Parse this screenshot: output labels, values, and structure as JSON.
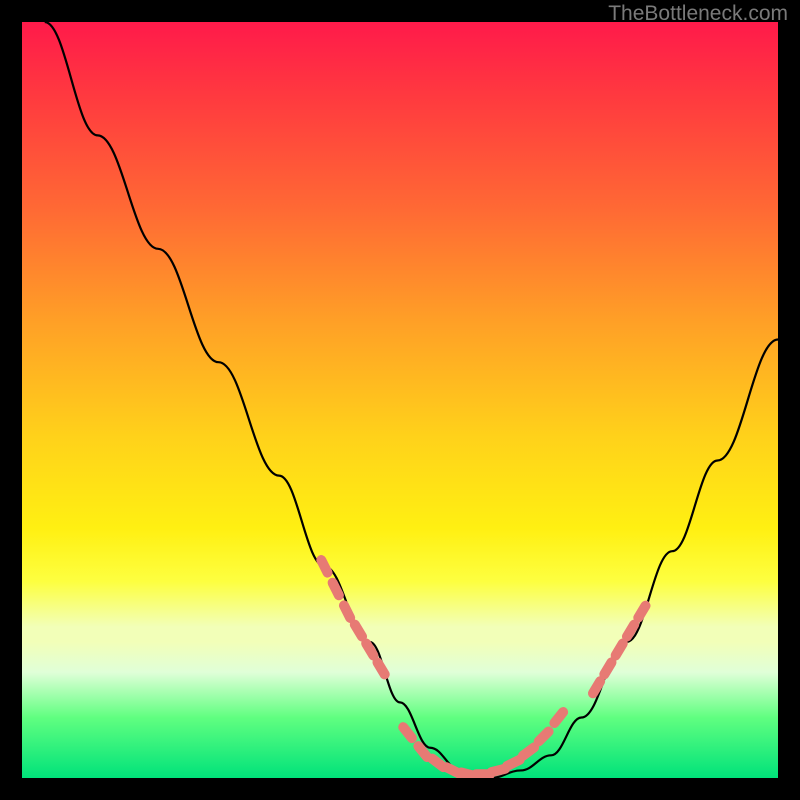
{
  "watermark": "TheBottleneck.com",
  "chart_data": {
    "type": "line",
    "title": "",
    "xlabel": "",
    "ylabel": "",
    "xlim": [
      0,
      100
    ],
    "ylim": [
      0,
      100
    ],
    "gradient_stops": [
      {
        "pos": 0,
        "color": "#ff1a4a"
      },
      {
        "pos": 10,
        "color": "#ff3a3f"
      },
      {
        "pos": 25,
        "color": "#ff6a34"
      },
      {
        "pos": 40,
        "color": "#ffa126"
      },
      {
        "pos": 55,
        "color": "#ffd21a"
      },
      {
        "pos": 67,
        "color": "#fff012"
      },
      {
        "pos": 74,
        "color": "#fdff40"
      },
      {
        "pos": 80,
        "color": "#f2ffb8"
      },
      {
        "pos": 86,
        "color": "#e0ffd8"
      },
      {
        "pos": 92,
        "color": "#60ff80"
      },
      {
        "pos": 100,
        "color": "#00e27a"
      }
    ],
    "series": [
      {
        "name": "bottleneck-curve",
        "color": "#000000",
        "x": [
          3,
          10,
          18,
          26,
          34,
          40,
          46,
          50,
          54,
          58,
          62,
          66,
          70,
          74,
          80,
          86,
          92,
          100
        ],
        "y": [
          100,
          85,
          70,
          55,
          40,
          28,
          18,
          10,
          4,
          1,
          0,
          1,
          3,
          8,
          18,
          30,
          42,
          58
        ]
      }
    ],
    "markers": {
      "name": "dotted-highlight",
      "color": "#e77a74",
      "segments": [
        {
          "x": [
            40,
            41.5,
            43,
            44.5,
            46,
            47.5
          ],
          "y": [
            28,
            25,
            22,
            19.5,
            17,
            14.5
          ]
        },
        {
          "x": [
            51,
            53,
            55,
            57,
            59,
            61,
            63,
            65,
            67,
            69,
            71
          ],
          "y": [
            6,
            3.5,
            2,
            1,
            0.5,
            0.5,
            1,
            2,
            3.5,
            5.5,
            8
          ]
        },
        {
          "x": [
            76,
            77.5,
            79,
            80.5,
            82
          ],
          "y": [
            12,
            14.5,
            17,
            19.5,
            22
          ]
        }
      ]
    }
  }
}
